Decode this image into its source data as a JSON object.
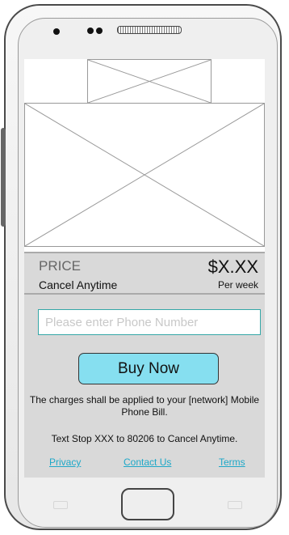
{
  "price": {
    "label": "PRICE",
    "value": "$X.XX",
    "cancel_text": "Cancel Anytime",
    "period": "Per week"
  },
  "phone_input": {
    "placeholder": "Please enter Phone Number",
    "value": ""
  },
  "buy_button": {
    "label": "Buy Now"
  },
  "disclaimer": {
    "charges": "The charges shall be applied to your [network] Mobile Phone Bill.",
    "stop": "Text Stop XXX to 80206 to Cancel Anytime."
  },
  "links": {
    "privacy": "Privacy",
    "contact": "Contact Us",
    "terms": "Terms"
  },
  "colors": {
    "button_fill": "#86dff0",
    "input_border": "#35a7a7",
    "link": "#1ea8c8",
    "panel": "#d9d9d9"
  }
}
